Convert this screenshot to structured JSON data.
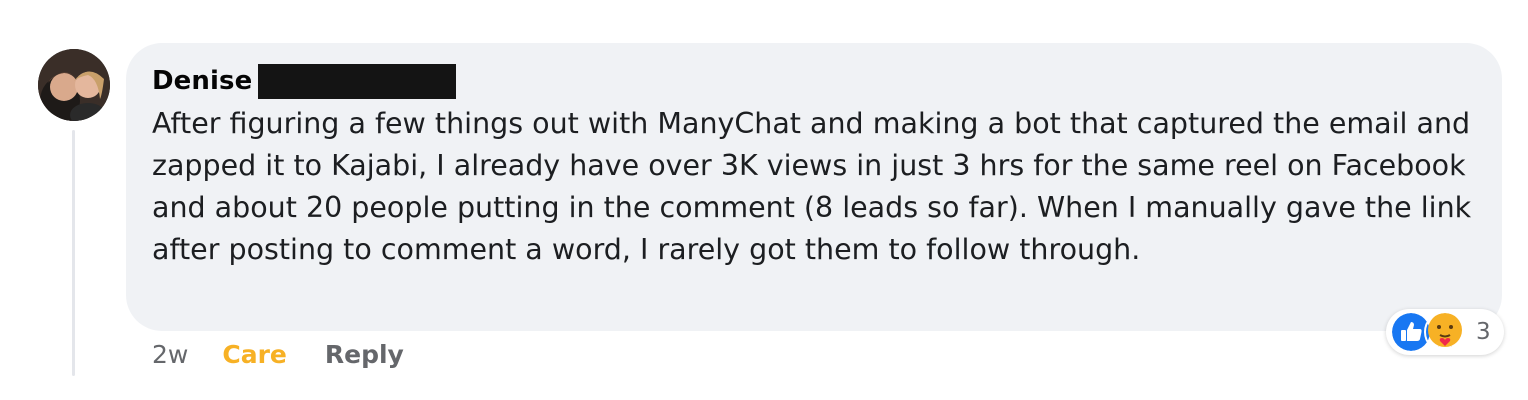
{
  "comment": {
    "author_first_name": "Denise",
    "text": "After figuring a few things out with ManyChat and making a bot that captured the email and zapped it to Kajabi, I already have over 3K views in just 3 hrs for the same reel on Facebook and about 20 people putting in the comment (8 leads so far). When I manually gave the link after posting to comment a word, I rarely got them to follow through.",
    "timestamp": "2w",
    "care_label": "Care",
    "reply_label": "Reply"
  },
  "reactions": {
    "icons": [
      "like-icon",
      "care-icon"
    ],
    "count": "3"
  },
  "colors": {
    "bubble_bg": "#f0f2f5",
    "care_accent": "#f7b125",
    "like_blue": "#1877f2",
    "secondary_text": "#65676b"
  }
}
